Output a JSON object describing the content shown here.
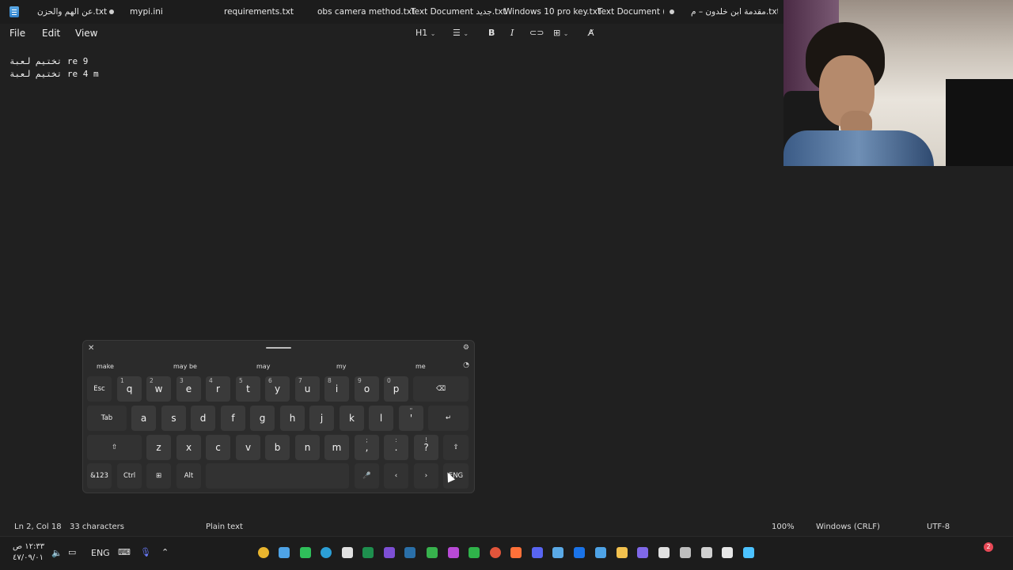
{
  "tabs": [
    {
      "label": "عن الهم والحزن.txt",
      "modified": true
    },
    {
      "label": "mypi.ini",
      "modified": false
    },
    {
      "label": "requirements.txt",
      "modified": false
    },
    {
      "label": "obs camera method.txt",
      "modified": false
    },
    {
      "label": "Text Document جديد.txt",
      "modified": false
    },
    {
      "label": "Windows 10 pro key.txt",
      "modified": false
    },
    {
      "label": "Text Document (T",
      "modified": true
    },
    {
      "label": "مقدمة ابن خلدون – م.txt",
      "modified": false
    }
  ],
  "menu": {
    "file": "File",
    "edit": "Edit",
    "view": "View"
  },
  "toolbar": {
    "heading": "H1",
    "list_icon": "list-icon",
    "bold": "B",
    "italic": "I",
    "link_icon": "link-icon",
    "table_icon": "table-icon",
    "clear_icon": "clear-format-icon"
  },
  "editor": {
    "lines": [
      "تختيم لعبة re 9",
      "تختيم لعبة re 4 m"
    ]
  },
  "keyboard": {
    "suggestions": [
      "make",
      "may be",
      "may",
      "my",
      "me"
    ],
    "row1": [
      {
        "k": "Esc"
      },
      {
        "k": "q",
        "n": "1"
      },
      {
        "k": "w",
        "n": "2"
      },
      {
        "k": "e",
        "n": "3"
      },
      {
        "k": "r",
        "n": "4"
      },
      {
        "k": "t",
        "n": "5"
      },
      {
        "k": "y",
        "n": "6"
      },
      {
        "k": "u",
        "n": "7"
      },
      {
        "k": "i",
        "n": "8"
      },
      {
        "k": "o",
        "n": "9"
      },
      {
        "k": "p",
        "n": "0"
      },
      {
        "k": "⌫"
      }
    ],
    "row2": [
      {
        "k": "Tab"
      },
      {
        "k": "a"
      },
      {
        "k": "s"
      },
      {
        "k": "d"
      },
      {
        "k": "f"
      },
      {
        "k": "g"
      },
      {
        "k": "h"
      },
      {
        "k": "j"
      },
      {
        "k": "k"
      },
      {
        "k": "l"
      },
      {
        "k": "'",
        "t": "\""
      },
      {
        "k": "↵"
      }
    ],
    "row3": [
      {
        "k": "⇧"
      },
      {
        "k": "z"
      },
      {
        "k": "x"
      },
      {
        "k": "c"
      },
      {
        "k": "v"
      },
      {
        "k": "b"
      },
      {
        "k": "n"
      },
      {
        "k": "m"
      },
      {
        "k": ",",
        "t": ";"
      },
      {
        "k": ".",
        "t": ":"
      },
      {
        "k": "?",
        "t": "!"
      },
      {
        "k": "⇧"
      }
    ],
    "row4": [
      {
        "k": "&123"
      },
      {
        "k": "Ctrl"
      },
      {
        "k": "⊞"
      },
      {
        "k": "Alt"
      },
      {
        "k": ""
      },
      {
        "k": "🎤"
      },
      {
        "k": "‹"
      },
      {
        "k": "›"
      },
      {
        "k": "ENG"
      }
    ]
  },
  "status": {
    "position": "Ln 2, Col 18",
    "chars": "33 characters",
    "mode": "Plain text",
    "zoom": "100%",
    "eol": "Windows (CRLF)",
    "encoding": "UTF-8"
  },
  "taskbar": {
    "time": "١٢:٣٣ ص",
    "date": "٤٧/٠٩/٠١",
    "lang": "ENG",
    "badge": "2"
  }
}
